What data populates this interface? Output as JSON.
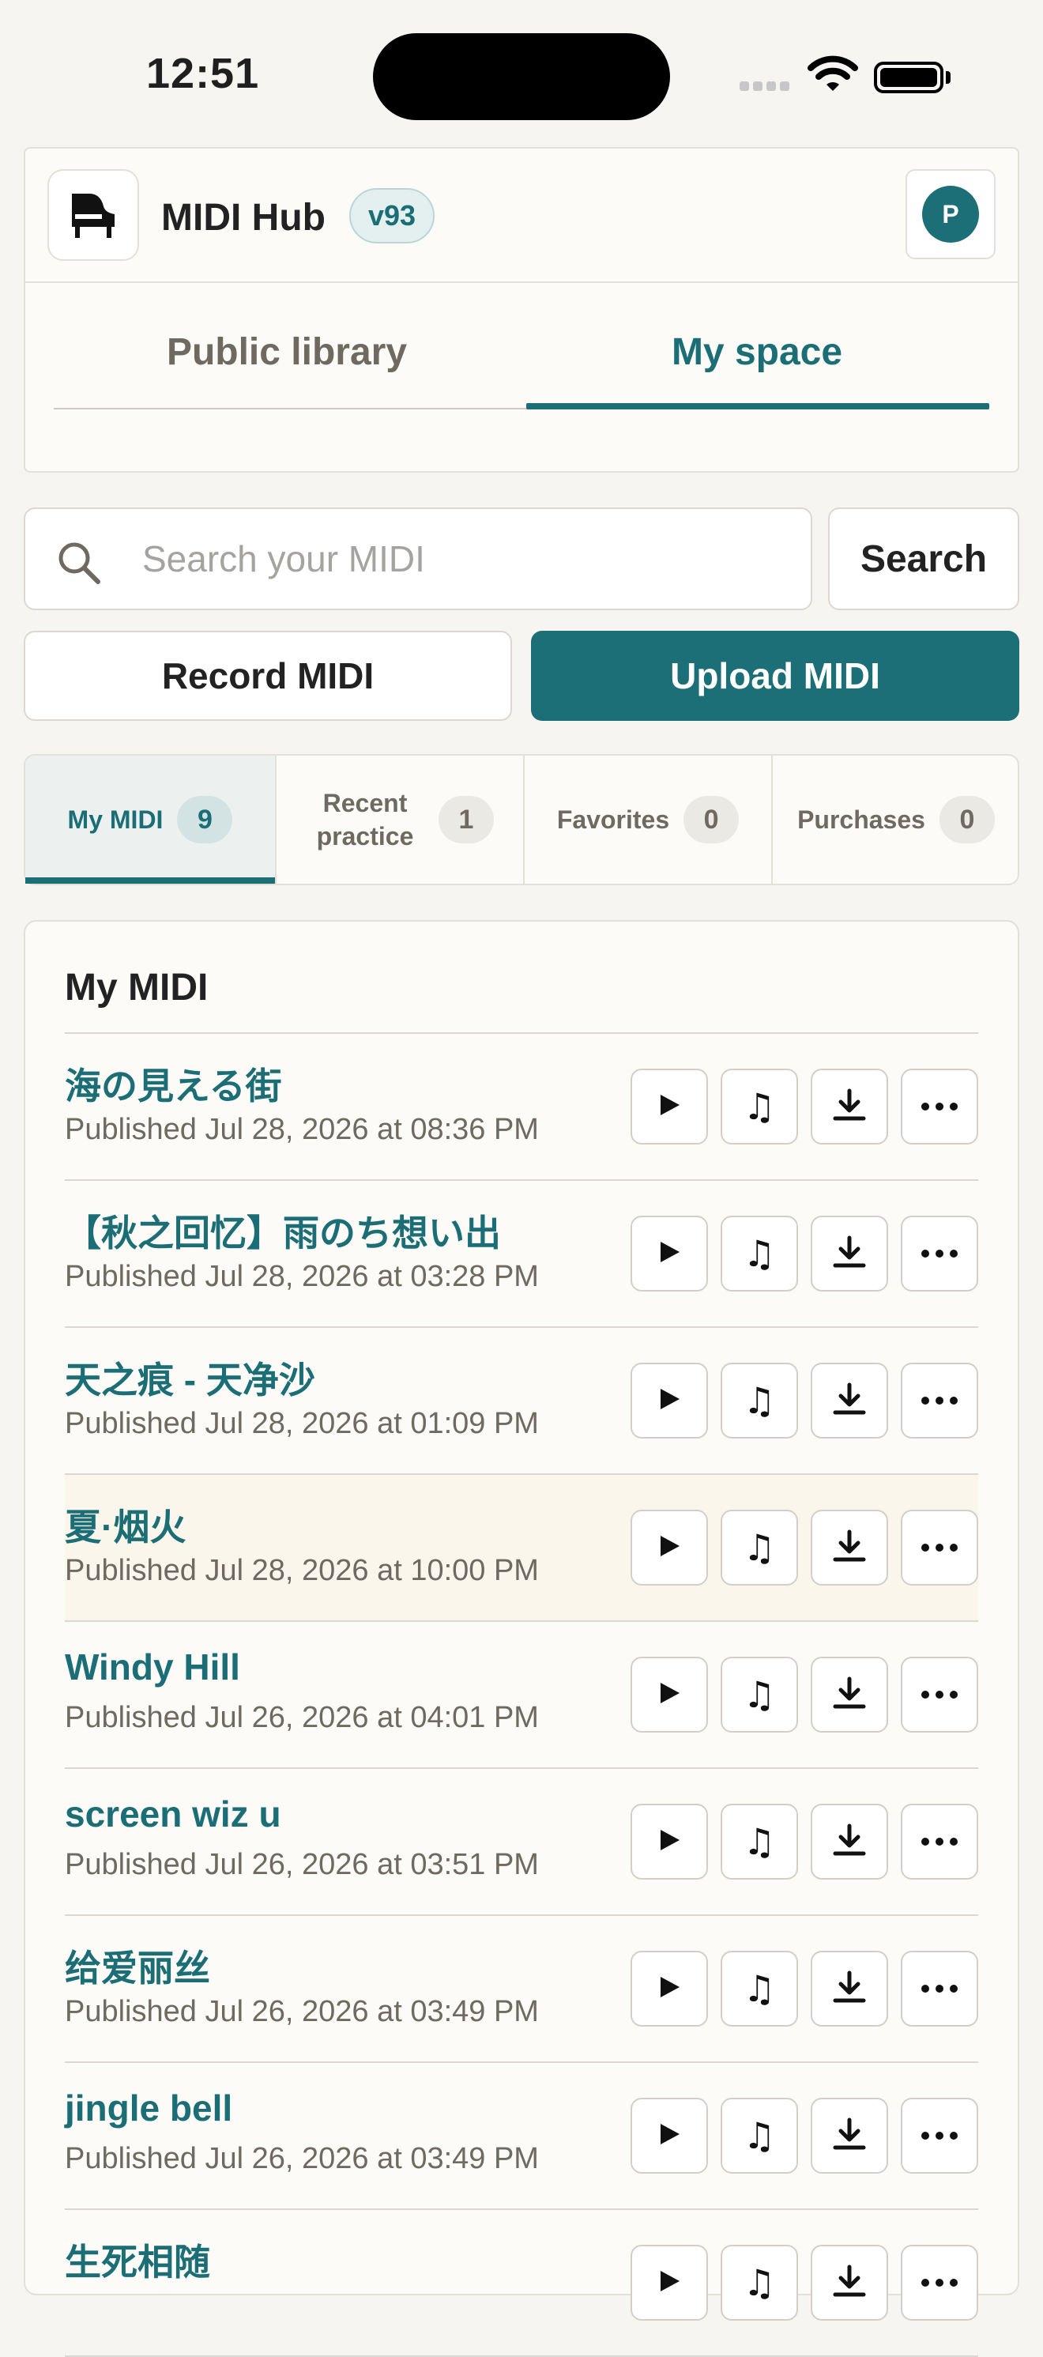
{
  "status_bar": {
    "time": "12:51"
  },
  "header": {
    "app_title": "MIDI Hub",
    "version": "v93",
    "avatar_initial": "P",
    "tabs": [
      {
        "label": "Public library",
        "active": false
      },
      {
        "label": "My space",
        "active": true
      }
    ]
  },
  "search": {
    "placeholder": "Search your MIDI",
    "value": "",
    "button_label": "Search"
  },
  "actions": {
    "record_label": "Record MIDI",
    "upload_label": "Upload MIDI"
  },
  "subtabs": [
    {
      "label": "My MIDI",
      "count": "9",
      "active": true
    },
    {
      "label": "Recent practice",
      "count": "1",
      "active": false
    },
    {
      "label": "Favorites",
      "count": "0",
      "active": false
    },
    {
      "label": "Purchases",
      "count": "0",
      "active": false
    }
  ],
  "list": {
    "title": "My MIDI",
    "items": [
      {
        "name": "海の見える街",
        "date": "Published Jul 28, 2026 at 08:36 PM"
      },
      {
        "name": "【秋之回忆】雨のち想い出",
        "date": "Published Jul 28, 2026 at 03:28 PM"
      },
      {
        "name": "天之痕 - 天净沙",
        "date": "Published Jul 28, 2026 at 01:09 PM"
      },
      {
        "name": "夏·烟火",
        "date": "Published Jul 28, 2026 at 10:00 PM",
        "highlighted": true
      },
      {
        "name": "Windy Hill",
        "date": "Published Jul 26, 2026 at 04:01 PM"
      },
      {
        "name": "screen wiz u",
        "date": "Published Jul 26, 2026 at 03:51 PM"
      },
      {
        "name": "给爱丽丝",
        "date": "Published Jul 26, 2026 at 03:49 PM"
      },
      {
        "name": "jingle bell",
        "date": "Published Jul 26, 2026 at 03:49 PM"
      },
      {
        "name": "生死相随",
        "date": ""
      }
    ]
  },
  "icons": {
    "logo": "grand-piano-icon",
    "search": "search-icon",
    "play": "play-icon",
    "note": "music-note-icon",
    "download": "download-icon",
    "more": "more-icon"
  },
  "colors": {
    "accent": "#1c6f77",
    "background": "#f7f5f1",
    "card": "#fcfbf7",
    "highlight_row": "#faf6ec"
  }
}
